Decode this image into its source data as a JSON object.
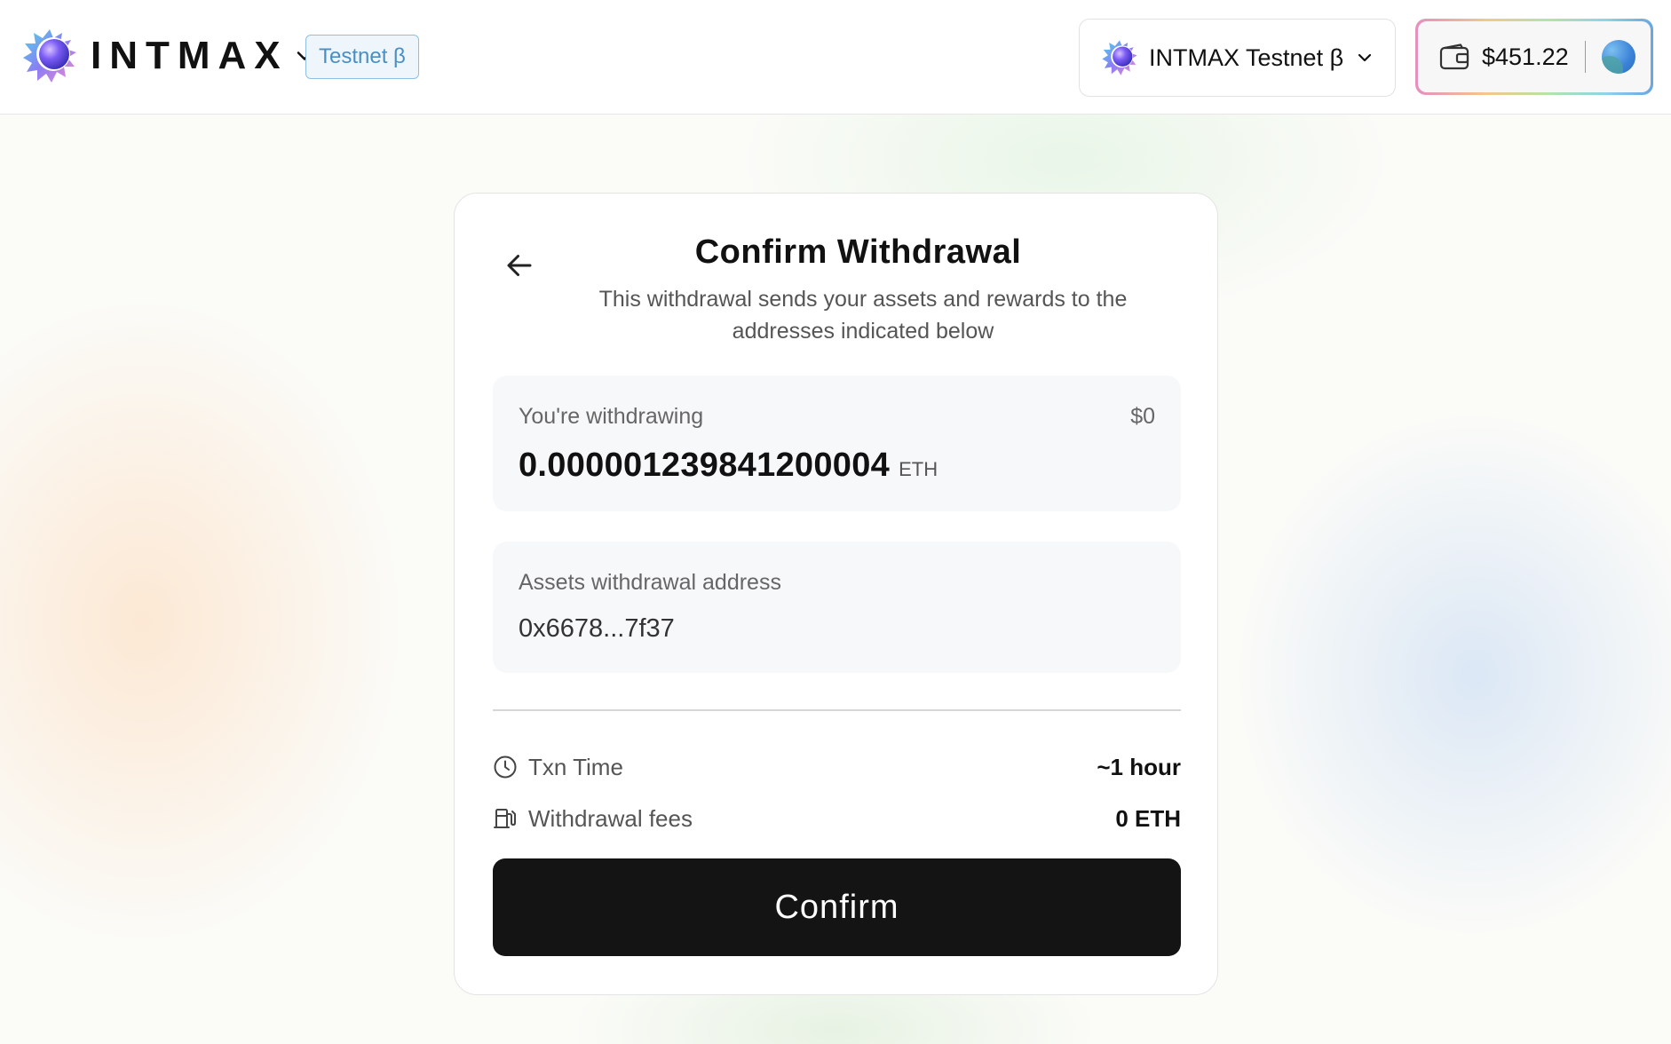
{
  "header": {
    "brand": {
      "wordmark": "INTMAX",
      "logo_icon": "intmax-logo-icon",
      "menu_icon": "chevron-down-icon"
    },
    "network_badge": "Testnet β",
    "network_selector": {
      "label": "INTMAX Testnet β",
      "icon": "intmax-logo-icon",
      "chevron": "chevron-down-icon"
    },
    "wallet": {
      "balance": "$451.22",
      "icon": "wallet-icon",
      "avatar": "account-avatar"
    }
  },
  "card": {
    "title": "Confirm Withdrawal",
    "subtitle": "This withdrawal sends your assets and rewards to the addresses indicated below",
    "back_icon": "arrow-left-icon",
    "amount": {
      "label": "You're withdrawing",
      "usd_value": "$0",
      "value": "0.000001239841200004",
      "unit": "ETH"
    },
    "address": {
      "label": "Assets withdrawal address",
      "value": "0x6678...7f37"
    },
    "details": [
      {
        "icon": "clock-icon",
        "label": "Txn Time",
        "value": "~1 hour"
      },
      {
        "icon": "fuel-pump-icon",
        "label": "Withdrawal fees",
        "value": "0 ETH"
      }
    ],
    "confirm_label": "Confirm"
  },
  "colors": {
    "accent_badge": "#4a8fc4",
    "button_bg": "#141414",
    "button_text": "#ffffff"
  }
}
